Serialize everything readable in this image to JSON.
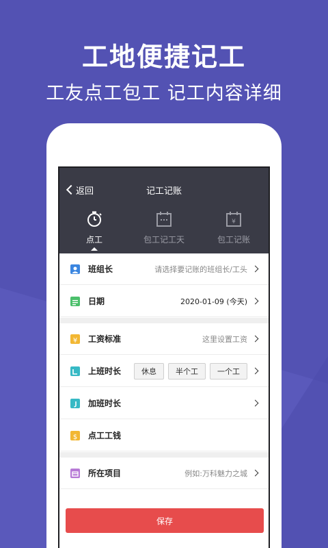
{
  "promo": {
    "headline": "工地便捷记工",
    "subline": "工友点工包工 记工内容详细"
  },
  "app": {
    "back_label": "返回",
    "title": "记工记账",
    "tabs": [
      {
        "label": "点工",
        "icon": "stopwatch-icon",
        "active": true
      },
      {
        "label": "包工记工天",
        "icon": "calendar-icon",
        "active": false
      },
      {
        "label": "包工记账",
        "icon": "calendar-yen-icon",
        "active": false
      }
    ],
    "rows": {
      "team_leader": {
        "label": "班组长",
        "value": "请选择要记账的班组长/工头",
        "icon": "person-icon",
        "icon_color": "#3b86e0"
      },
      "date": {
        "label": "日期",
        "value": "2020-01-09 (今天)",
        "icon": "calendar-list-icon",
        "icon_color": "#4bbf6b"
      },
      "wage_standard": {
        "label": "工资标准",
        "value": "这里设置工资",
        "icon": "yen-icon",
        "icon_color": "#f2b733"
      },
      "work_hours": {
        "label": "上班时长",
        "options": [
          "休息",
          "半个工",
          "一个工"
        ],
        "icon": "clock-icon",
        "icon_color": "#37b9c5"
      },
      "overtime": {
        "label": "加班时长",
        "icon": "overtime-icon",
        "icon_color": "#37b9c5"
      },
      "pay": {
        "label": "点工工钱",
        "icon": "dollar-icon",
        "icon_color": "#f2b733"
      },
      "project": {
        "label": "所在项目",
        "value": "例如:万科魅力之城",
        "icon": "folder-icon",
        "icon_color": "#b77ad6"
      }
    },
    "save_label": "保存"
  },
  "colors": {
    "background": "#5352b3",
    "header": "#3a3b46",
    "save_button": "#e74c4c"
  }
}
